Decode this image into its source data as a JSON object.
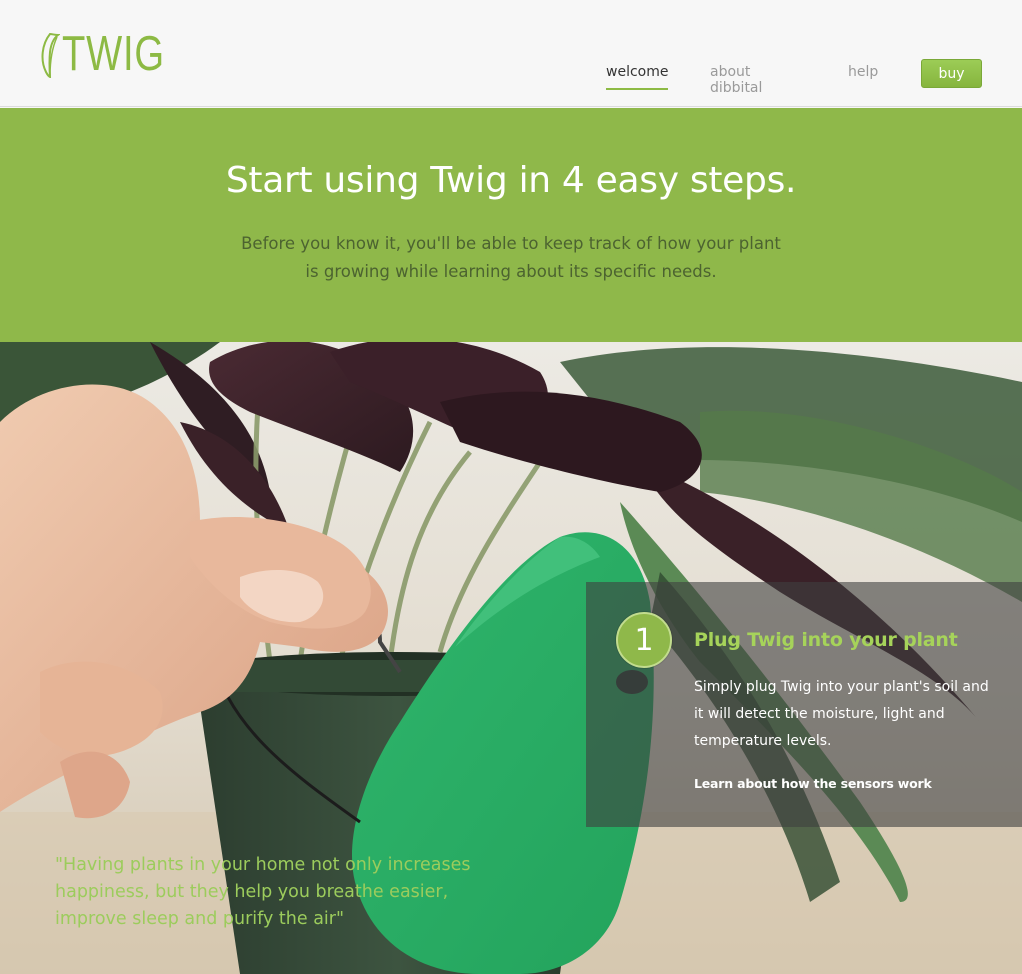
{
  "brand": {
    "logo_text": "TWIG",
    "accent_color": "#8dba44",
    "logo_icon": "leaf-icon"
  },
  "nav": {
    "items": [
      {
        "label": "welcome",
        "active": true
      },
      {
        "label": "about dibbital",
        "active": false
      },
      {
        "label": "help",
        "active": false
      }
    ],
    "buy_label": "buy"
  },
  "hero": {
    "title": "Start using Twig in 4 easy steps.",
    "subtitle": "Before you know it, you'll be able to keep track of how your plant is growing while learning about its specific needs.",
    "background_color": "#8fb84a"
  },
  "step": {
    "number": "1",
    "title": "Plug Twig into your plant",
    "text": "Simply plug Twig into your plant's soil and it will detect the moisture, light and temperature levels.",
    "link": "Learn about how the sensors work"
  },
  "quote": {
    "text": "\"Having plants in your home not only increases happiness, but they help you breathe easier, improve sleep and purify the air\""
  }
}
